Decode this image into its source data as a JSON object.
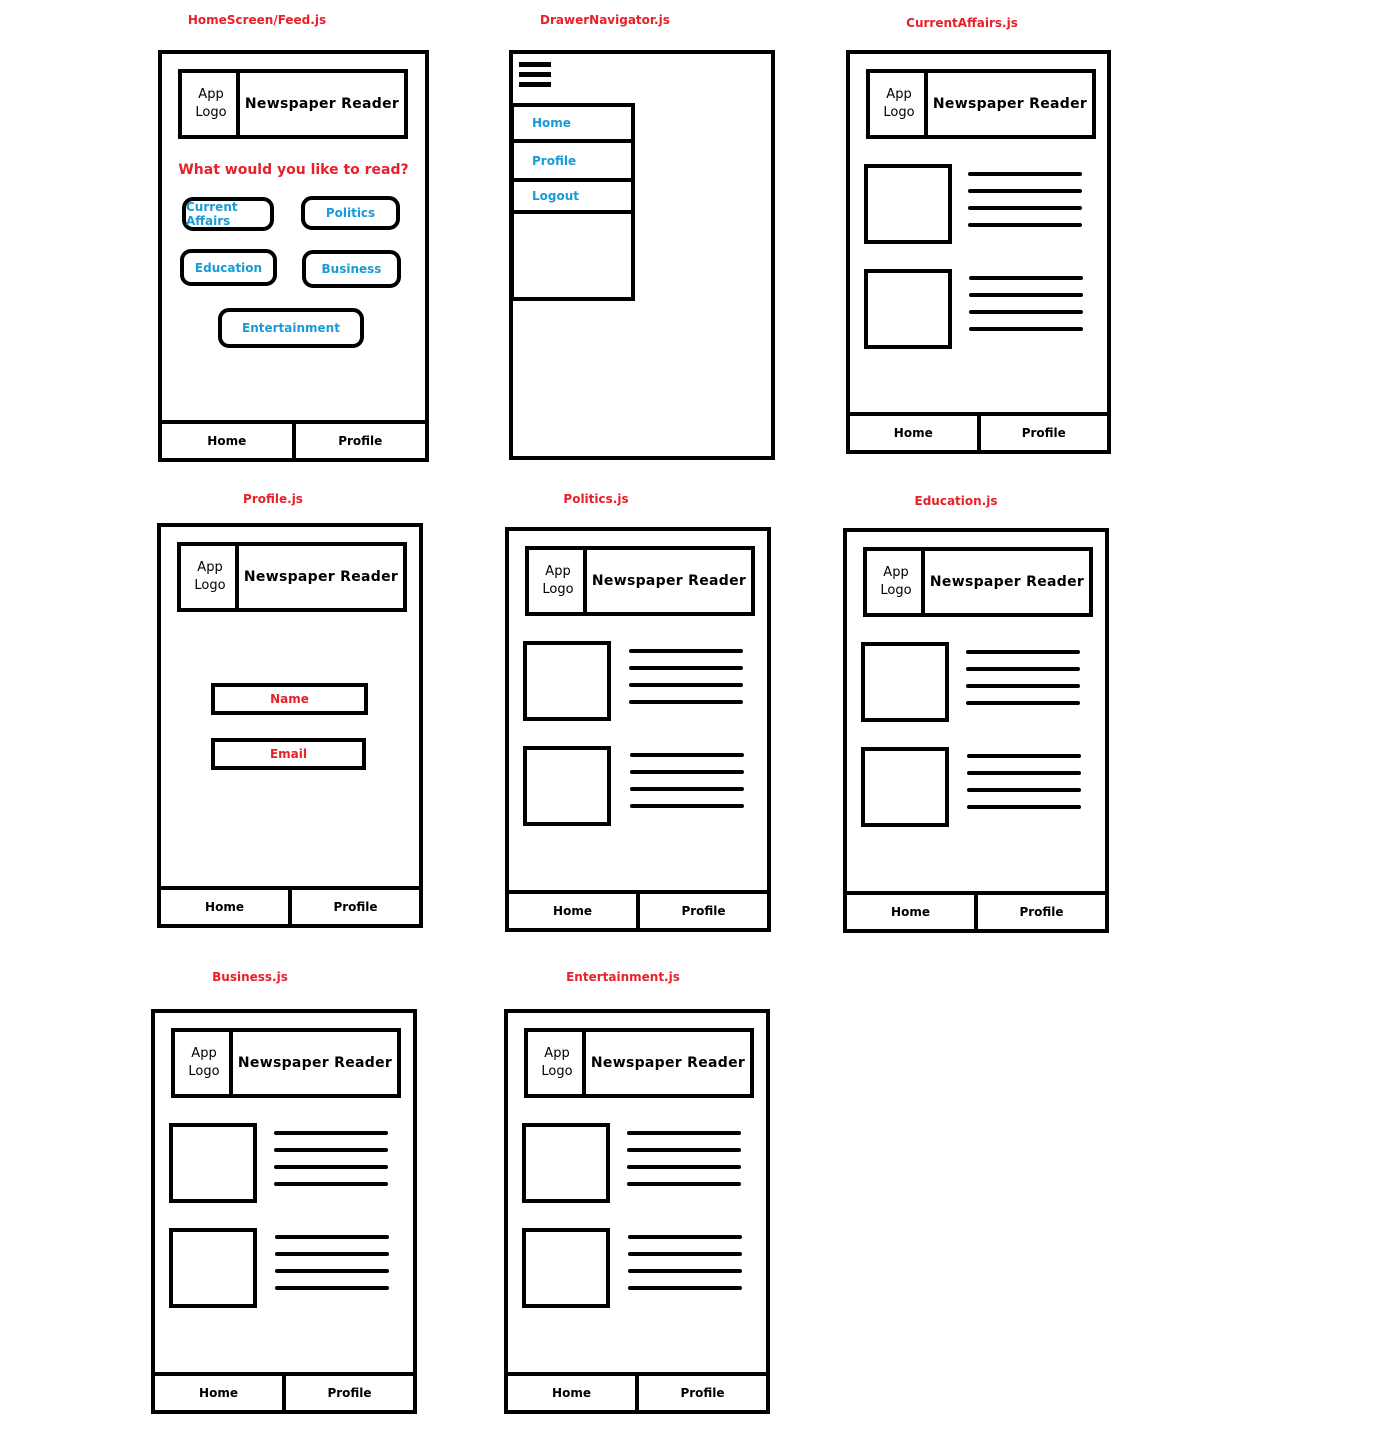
{
  "captions": {
    "home": "HomeScreen/Feed.js",
    "drawer": "DrawerNavigator.js",
    "current_affairs": "CurrentAffairs.js",
    "profile": "Profile.js",
    "politics": "Politics.js",
    "education": "Education.js",
    "business": "Business.js",
    "entertainment": "Entertainment.js"
  },
  "app": {
    "logo_line1": "App",
    "logo_line2": "Logo",
    "title": "Newspaper Reader"
  },
  "nav": {
    "home": "Home",
    "profile": "Profile"
  },
  "home": {
    "question": "What would you like to read?",
    "categories": [
      "Current Affairs",
      "Politics",
      "Education",
      "Business",
      "Entertainment"
    ]
  },
  "drawer": {
    "items": [
      "Home",
      "Profile",
      "Logout"
    ]
  },
  "profile": {
    "name_field": "Name",
    "email_field": "Email"
  },
  "colors": {
    "caption": "#e8202a",
    "link": "#1a9ad6",
    "outline": "#000000"
  }
}
